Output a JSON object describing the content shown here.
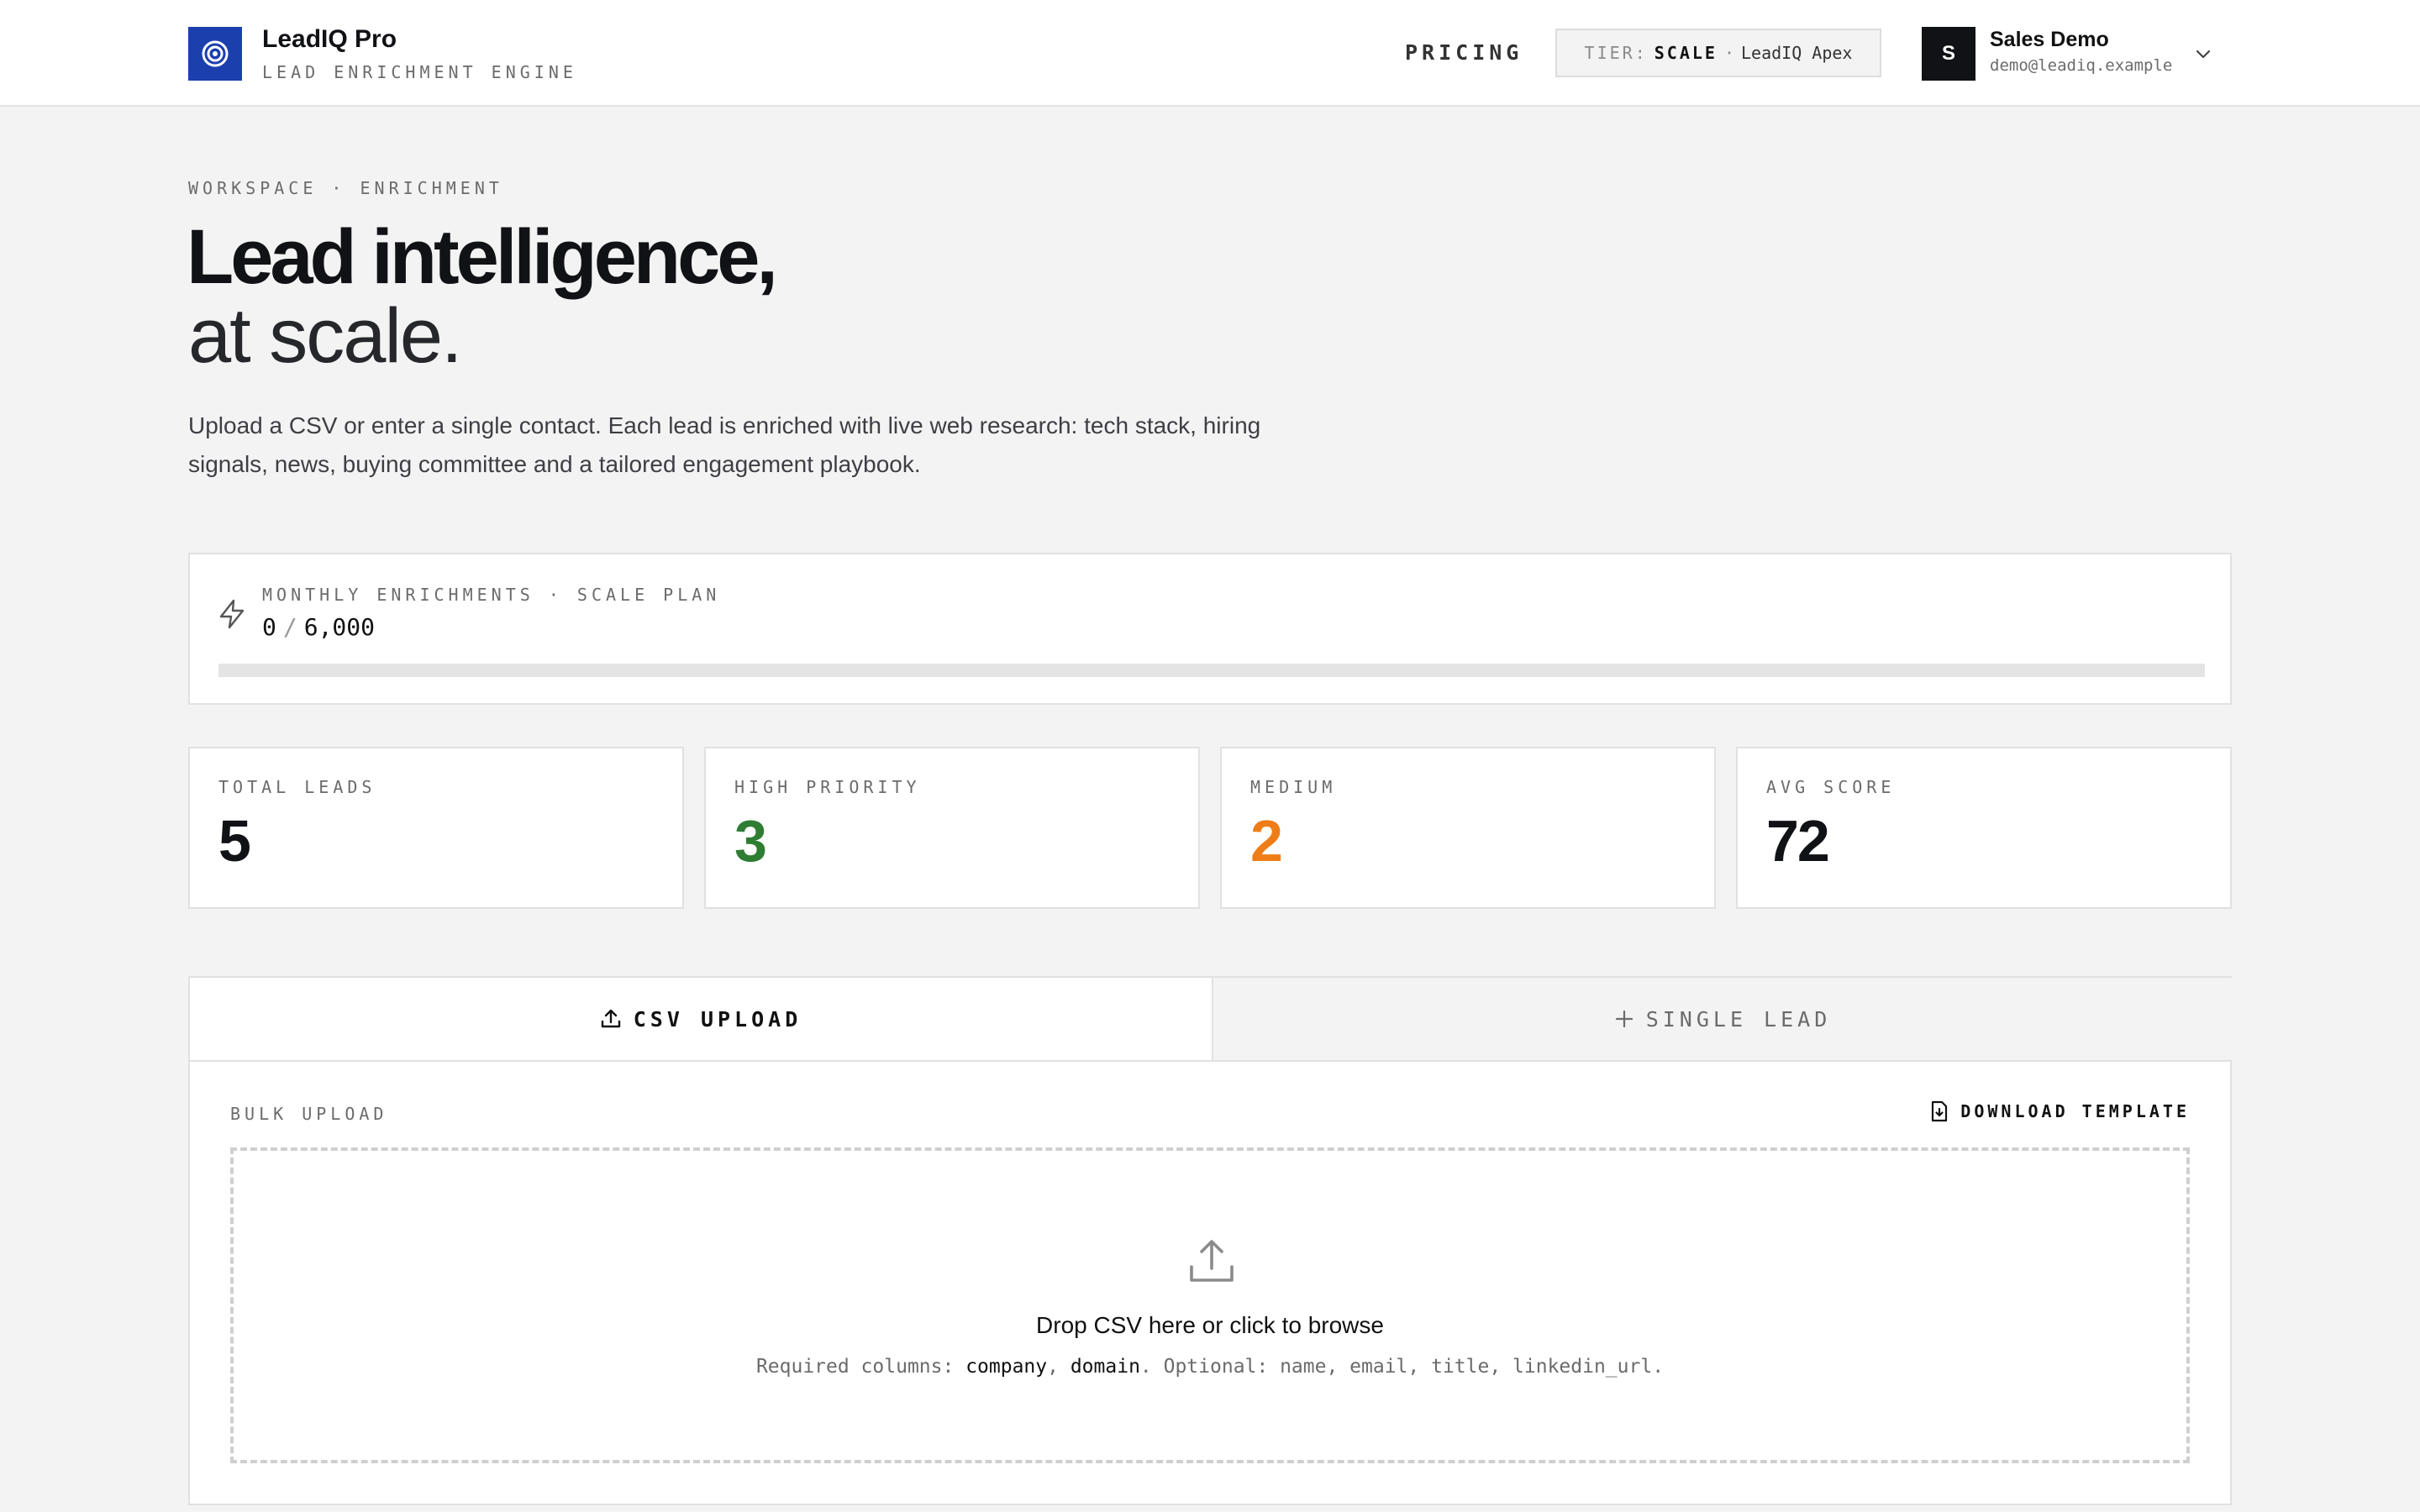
{
  "header": {
    "brand_name": "LeadIQ Pro",
    "brand_tagline": "LEAD ENRICHMENT ENGINE",
    "nav_pricing": "PRICING",
    "tier": {
      "key": "TIER:",
      "value": "SCALE",
      "dot": "·",
      "product": "LeadIQ Apex"
    },
    "user": {
      "initial": "S",
      "name": "Sales Demo",
      "email": "demo@leadiq.example"
    }
  },
  "hero": {
    "breadcrumb": "WORKSPACE · ENRICHMENT",
    "title_line1": "Lead intelligence,",
    "title_line2": "at scale.",
    "description": "Upload a CSV or enter a single contact. Each lead is enriched with live web research: tech stack, hiring signals, news, buying committee and a tailored engagement playbook."
  },
  "quota": {
    "label": "MONTHLY ENRICHMENTS · SCALE PLAN",
    "used": "0",
    "separator": "/",
    "limit": "6,000",
    "used_fraction": 0
  },
  "stats": [
    {
      "label": "TOTAL LEADS",
      "value": "5",
      "color": "#111216"
    },
    {
      "label": "HIGH PRIORITY",
      "value": "3",
      "color": "#2e7d32"
    },
    {
      "label": "MEDIUM",
      "value": "2",
      "color": "#ef7d17"
    },
    {
      "label": "AVG SCORE",
      "value": "72",
      "color": "#111216"
    }
  ],
  "upload": {
    "tabs": [
      {
        "label": "CSV UPLOAD",
        "icon": "upload-icon",
        "active": true
      },
      {
        "label": "SINGLE LEAD",
        "icon": "plus-icon",
        "active": false
      }
    ],
    "section_label": "BULK UPLOAD",
    "download_template": "DOWNLOAD TEMPLATE",
    "dropzone": {
      "title": "Drop CSV here or click to browse",
      "hint_prefix": "Required columns: ",
      "required_1": "company",
      "comma": ", ",
      "required_2": "domain",
      "hint_suffix": ". Optional: name, email, title, linkedin_url."
    }
  },
  "colors": {
    "brand": "#1c3fae",
    "high_priority": "#2e7d32",
    "medium": "#ef7d17"
  }
}
